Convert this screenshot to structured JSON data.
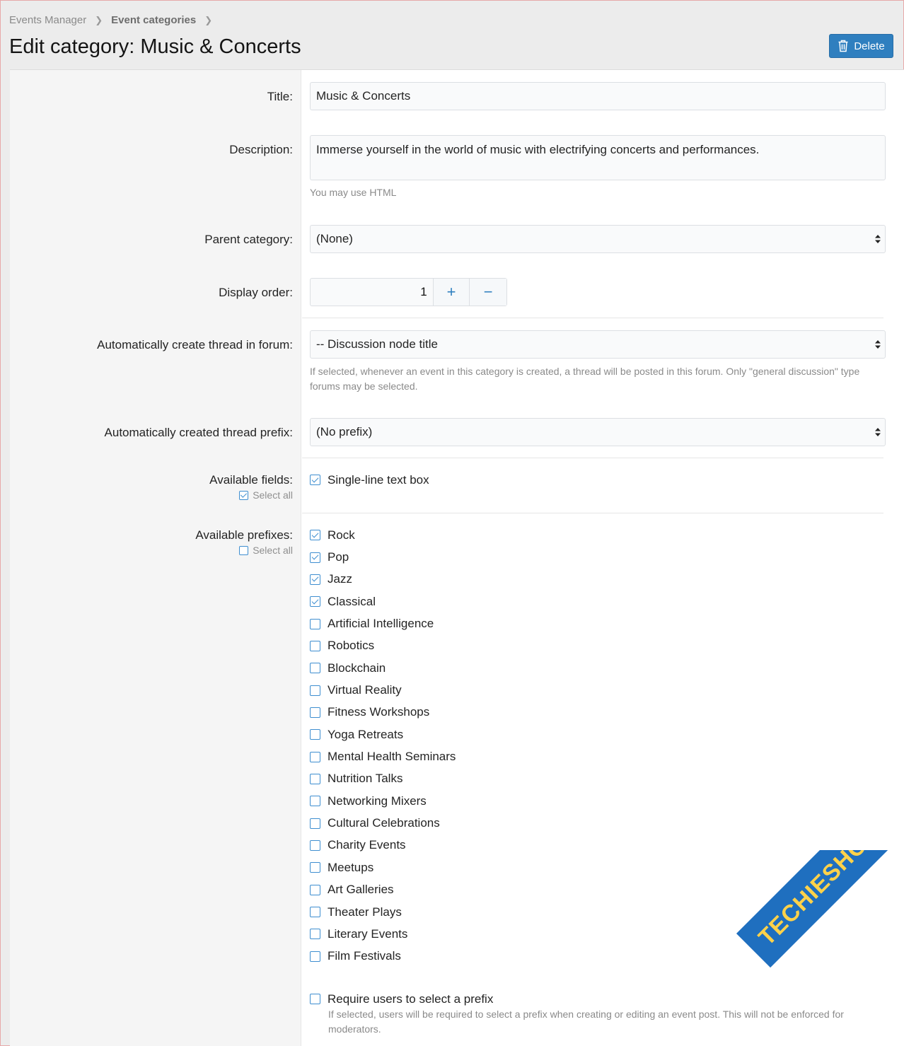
{
  "breadcrumb": {
    "item1": "Events Manager",
    "item2": "Event categories"
  },
  "page": {
    "title": "Edit category: Music & Concerts"
  },
  "toolbar": {
    "delete_label": "Delete"
  },
  "form": {
    "title": {
      "label": "Title:",
      "value": "Music & Concerts"
    },
    "description": {
      "label": "Description:",
      "value": "Immerse yourself in the world of music with electrifying concerts and performances.",
      "hint": "You may use HTML"
    },
    "parent_category": {
      "label": "Parent category:",
      "value": "(None)"
    },
    "display_order": {
      "label": "Display order:",
      "value": "1",
      "plus": "+",
      "minus": "−"
    },
    "auto_thread_forum": {
      "label": "Automatically create thread in forum:",
      "value": "-- Discussion node title",
      "hint": "If selected, whenever an event in this category is created, a thread will be posted in this forum. Only \"general discussion\" type forums may be selected."
    },
    "auto_thread_prefix": {
      "label": "Automatically created thread prefix:",
      "value": "(No prefix)"
    },
    "available_fields": {
      "label": "Available fields:",
      "select_all": "Select all",
      "select_all_checked": true,
      "items": [
        {
          "label": "Single-line text box",
          "checked": true
        }
      ]
    },
    "available_prefixes": {
      "label": "Available prefixes:",
      "select_all": "Select all",
      "select_all_checked": false,
      "items": [
        {
          "label": "Rock",
          "checked": true
        },
        {
          "label": "Pop",
          "checked": true
        },
        {
          "label": "Jazz",
          "checked": true
        },
        {
          "label": "Classical",
          "checked": true
        },
        {
          "label": "Artificial Intelligence",
          "checked": false
        },
        {
          "label": "Robotics",
          "checked": false
        },
        {
          "label": "Blockchain",
          "checked": false
        },
        {
          "label": "Virtual Reality",
          "checked": false
        },
        {
          "label": "Fitness Workshops",
          "checked": false
        },
        {
          "label": "Yoga Retreats",
          "checked": false
        },
        {
          "label": "Mental Health Seminars",
          "checked": false
        },
        {
          "label": "Nutrition Talks",
          "checked": false
        },
        {
          "label": "Networking Mixers",
          "checked": false
        },
        {
          "label": "Cultural Celebrations",
          "checked": false
        },
        {
          "label": "Charity Events",
          "checked": false
        },
        {
          "label": "Meetups",
          "checked": false
        },
        {
          "label": "Art Galleries",
          "checked": false
        },
        {
          "label": "Theater Plays",
          "checked": false
        },
        {
          "label": "Literary Events",
          "checked": false
        },
        {
          "label": "Film Festivals",
          "checked": false
        }
      ]
    },
    "require_prefix": {
      "label": "Require users to select a prefix",
      "checked": false,
      "hint": "If selected, users will be required to select a prefix when creating or editing an event post. This will not be enforced for moderators."
    }
  },
  "watermark": {
    "text": "TECHIESHOME.COM"
  },
  "colors": {
    "accent": "#2f7fbf",
    "label_bg": "#f5f5f5",
    "page_bg": "#ececec"
  }
}
